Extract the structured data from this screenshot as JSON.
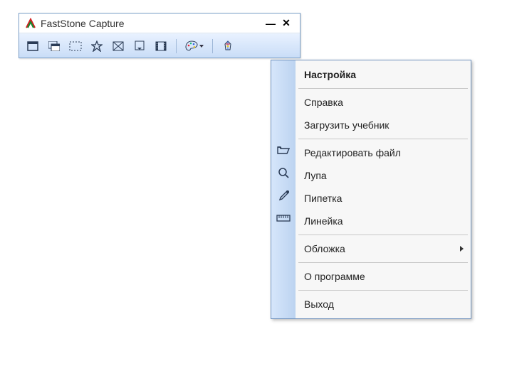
{
  "window": {
    "title": "FastStone Capture",
    "controls": {
      "minimize": "—",
      "close": "✕"
    }
  },
  "toolbar_icons": [
    "capture-window-icon",
    "capture-foreground-icon",
    "capture-region-icon",
    "capture-freehand-icon",
    "capture-fullscreen-icon",
    "capture-scroll-icon",
    "capture-video-icon",
    "palette-icon",
    "settings-dropdown-icon"
  ],
  "menu": {
    "groups": [
      [
        {
          "key": "settings",
          "label": "Настройка",
          "bold": true,
          "icon": null
        }
      ],
      [
        {
          "key": "help",
          "label": "Справка",
          "icon": null
        },
        {
          "key": "load-tutorial",
          "label": "Загрузить учебник",
          "icon": null
        }
      ],
      [
        {
          "key": "edit-file",
          "label": "Редактировать файл",
          "icon": "folder-open-icon"
        },
        {
          "key": "magnifier",
          "label": "Лупа",
          "icon": "magnifier-icon"
        },
        {
          "key": "eyedropper",
          "label": "Пипетка",
          "icon": "eyedropper-icon"
        },
        {
          "key": "ruler",
          "label": "Линейка",
          "icon": "ruler-icon"
        }
      ],
      [
        {
          "key": "skin",
          "label": "Обложка",
          "icon": null,
          "submenu": true
        }
      ],
      [
        {
          "key": "about",
          "label": "О программе",
          "icon": null
        }
      ],
      [
        {
          "key": "exit",
          "label": "Выход",
          "icon": null
        }
      ]
    ]
  }
}
